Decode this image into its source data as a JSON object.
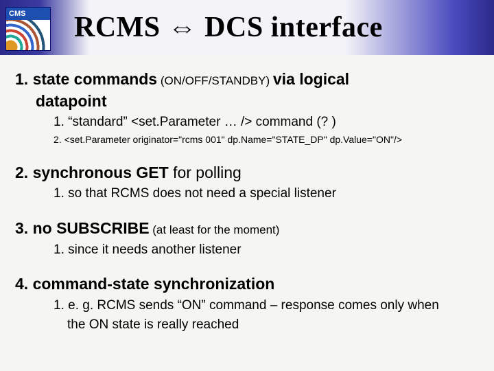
{
  "logo": {
    "label": "CMS"
  },
  "title": "RCMS ⇔ DCS interface",
  "items": [
    {
      "num": "1.",
      "lead_bold": "state commands",
      "lead_small": " (ON/OFF/STANDBY) ",
      "lead_tail": "via logical",
      "cont": "datapoint",
      "subs": [
        {
          "cls": "sub",
          "text": "1. “standard” <set.Parameter … /> command (? )"
        },
        {
          "cls": "sub-small",
          "text": "2.  <set.Parameter originator=\"rcms 001\" dp.Name=\"STATE_DP\" dp.Value=\"ON\"/>"
        }
      ]
    },
    {
      "num": "2.",
      "lead_bold": "synchronous GET",
      "lead_tail": " for polling",
      "subs": [
        {
          "cls": "sub",
          "text": "1. so that RCMS does not need a special listener"
        }
      ]
    },
    {
      "num": "3.",
      "lead_bold": "no SUBSCRIBE",
      "lead_small": " (at least for the moment)",
      "subs": [
        {
          "cls": "sub",
          "text": "1. since it needs another listener"
        }
      ]
    },
    {
      "num": "4.",
      "lead_bold": "command-state synchronization",
      "subs": [
        {
          "cls": "sub",
          "text": "1. e. g. RCMS sends “ON” command – response comes only when"
        },
        {
          "cls": "sub",
          "text_cont": "the ON state is really reached"
        }
      ]
    }
  ]
}
